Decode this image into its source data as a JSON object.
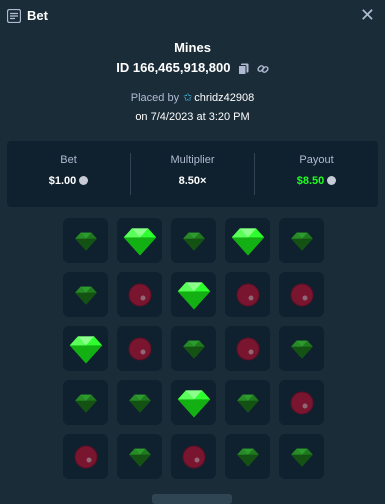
{
  "header": {
    "title": "Bet",
    "close_icon": "close-icon",
    "icon": "bet-slip-icon"
  },
  "game": {
    "name": "Mines"
  },
  "bet_id": {
    "label": "ID 166,465,918,800"
  },
  "placed": {
    "prefix": "Placed by",
    "username": "chridz42908",
    "date": "on 7/4/2023 at 3:20 PM"
  },
  "stats": {
    "bet": {
      "label": "Bet",
      "value": "$1.00"
    },
    "multiplier": {
      "label": "Multiplier",
      "value": "8.50×"
    },
    "payout": {
      "label": "Payout",
      "value": "$8.50"
    }
  },
  "colors": {
    "bg": "#1a2c38",
    "panel": "#0f212e",
    "payout": "#1fff20",
    "gem_bright": "#2eff2e",
    "gem_dim": "#1f7a1f",
    "mine": "#7a1530"
  },
  "grid": [
    [
      "gem",
      "gem-revealed",
      "gem",
      "gem-revealed",
      "gem"
    ],
    [
      "gem",
      "mine",
      "gem-revealed",
      "mine",
      "mine"
    ],
    [
      "gem-revealed",
      "mine",
      "gem",
      "mine",
      "gem"
    ],
    [
      "gem",
      "gem",
      "gem-revealed",
      "gem",
      "mine"
    ],
    [
      "mine",
      "gem",
      "mine",
      "gem",
      "gem"
    ]
  ]
}
